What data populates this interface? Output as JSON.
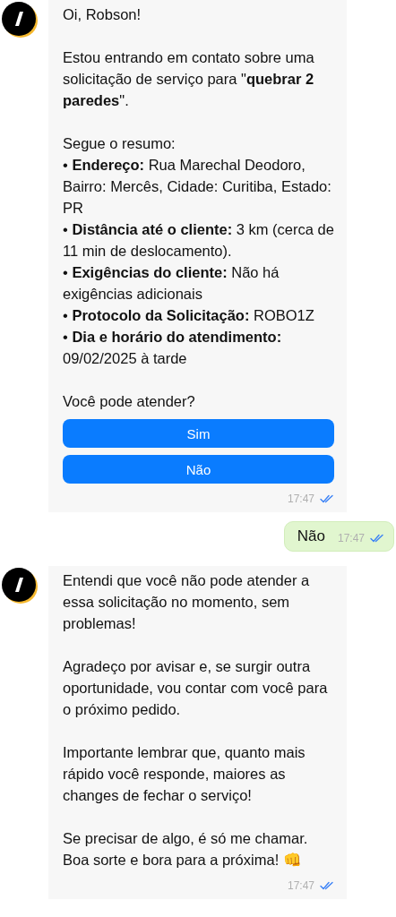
{
  "messages": [
    {
      "kind": "incoming",
      "paragraphs": [
        "Oi,  Robson!",
        "Estou entrando em contato sobre uma solicitação de serviço para \"**quebrar 2 paredes**\"."
      ],
      "summary": {
        "heading": "Segue o resumo:",
        "items": [
          "• **Endereço:**  Rua Marechal Deodoro, Bairro: Mercês, Cidade: Curitiba, Estado: PR",
          "• **Distância até o cliente:**  3 km (cerca de 11 min de deslocamento).",
          "• **Exigências do cliente:**  Não há exigências adicionais",
          "• **Protocolo da Solicitação:** ROBO1Z",
          "• **Dia e horário do atendimento:** 09/02/2025 à tarde"
        ]
      },
      "question": "Você pode atender?",
      "buttons": [
        "Sim",
        "Não"
      ],
      "time": "17:47",
      "read": true
    },
    {
      "kind": "outgoing",
      "text": "Não",
      "time": "17:47",
      "read": true
    },
    {
      "kind": "incoming",
      "paragraphs": [
        "Entendi que você não pode atender a essa solicitação no momento, sem problemas!",
        "Agradeço por avisar e, se surgir outra oportunidade, vou contar com você para o próximo pedido.",
        "Importante lembrar que, quanto mais rápido você responde, maiores as changes de fechar o serviço!",
        "Se precisar de algo, é só me chamar. Boa sorte e bora para a próxima! 👊"
      ],
      "time": "17:47",
      "read": true
    }
  ]
}
